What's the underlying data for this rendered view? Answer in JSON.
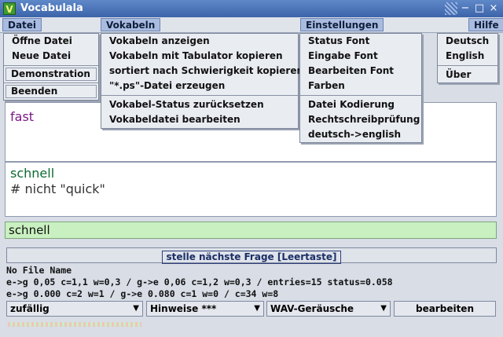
{
  "window": {
    "title": "Vocabulala",
    "icon_letter": "V",
    "minimize": "−",
    "maximize": "□",
    "close": "×"
  },
  "menubar": {
    "datei": "Datei",
    "vokabeln": "Vokabeln",
    "einstellungen": "Einstellungen",
    "hilfe": "Hilfe"
  },
  "menu_datei": [
    "Öffne Datei",
    "Neue Datei",
    "Demonstration",
    "Beenden"
  ],
  "menu_vokabeln": [
    "Vokabeln anzeigen",
    "Vokabeln mit Tabulator kopieren",
    "sortiert nach Schwierigkeit kopieren",
    "\"*.ps\"-Datei erzeugen",
    "Vokabel-Status zurücksetzen",
    "Vokabeldatei bearbeiten"
  ],
  "menu_einstellungen": [
    "Status Font",
    "Eingabe Font",
    "Bearbeiten Font",
    "Farben",
    "Datei Kodierung",
    "Rechtschreibprüfung",
    "deutsch->english"
  ],
  "menu_hilfe": [
    "Deutsch",
    "English",
    "Über"
  ],
  "question": "fast",
  "answer": {
    "word": "schnell",
    "note": "# nicht \"quick\""
  },
  "input_value": "schnell",
  "next_button": "stelle nächste Frage  [Leertaste]",
  "status": {
    "file": "No File Name",
    "line1": "e->g 0,05 c=1,1 w=0,3  /  g->e 0,06 c=1,2 w=0,3  / entries=15 status=0.058",
    "line2": "e->g 0.000 c=2 w=1  /  g->e 0.080 c=1 w=0  / c=34 w=8"
  },
  "controls": {
    "order": "zufällig",
    "hints": "Hinweise ***",
    "sounds": "WAV-Geräusche",
    "edit": "bearbeiten"
  },
  "colors": {
    "title_bar": "#4b73b8",
    "question_text": "#7a1a84",
    "answer_text": "#0c6b30",
    "input_bg": "#c9f0c0"
  }
}
